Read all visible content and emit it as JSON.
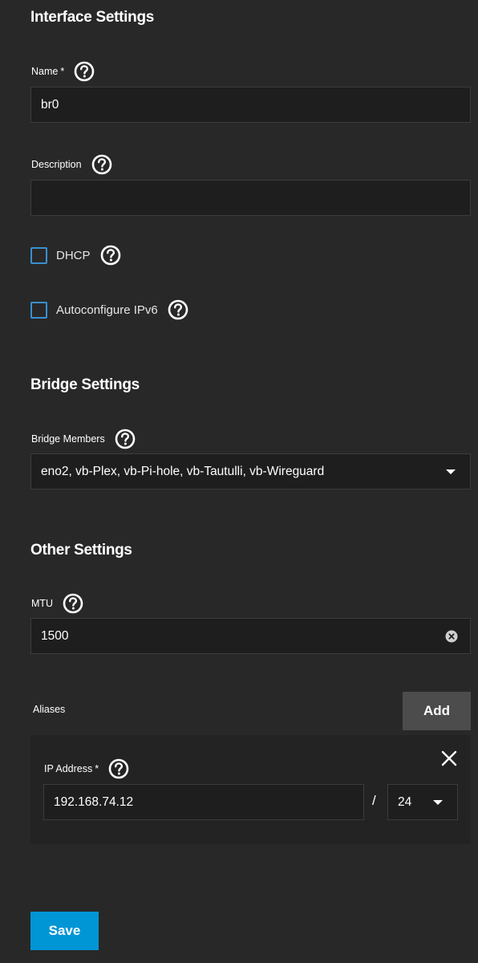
{
  "sections": {
    "interface": "Interface Settings",
    "bridge": "Bridge Settings",
    "other": "Other Settings"
  },
  "fields": {
    "name": {
      "label": "Name",
      "required_mark": "*",
      "value": "br0"
    },
    "description": {
      "label": "Description",
      "value": ""
    },
    "dhcp": {
      "label": "DHCP",
      "checked": false
    },
    "ipv6": {
      "label": "Autoconfigure IPv6",
      "checked": false
    },
    "bridge_members": {
      "label": "Bridge Members",
      "value": "eno2, vb-Plex, vb-Pi-hole, vb-Tautulli, vb-Wireguard"
    },
    "mtu": {
      "label": "MTU",
      "value": "1500"
    }
  },
  "aliases": {
    "label": "Aliases",
    "add_label": "Add",
    "items": [
      {
        "ip_label": "IP Address",
        "required_mark": "*",
        "ip_value": "192.168.74.12",
        "separator": "/",
        "netmask": "24"
      }
    ]
  },
  "actions": {
    "save_label": "Save"
  },
  "icons": {
    "help": "help-circle-icon",
    "dropdown": "caret-down-icon",
    "clear": "clear-circle-icon",
    "close": "close-icon"
  },
  "colors": {
    "background": "#282828",
    "input_bg": "#1e1e1e",
    "primary": "#0095d5",
    "checkbox_border": "#3a8fd0",
    "secondary_button": "#4c4c4c"
  }
}
